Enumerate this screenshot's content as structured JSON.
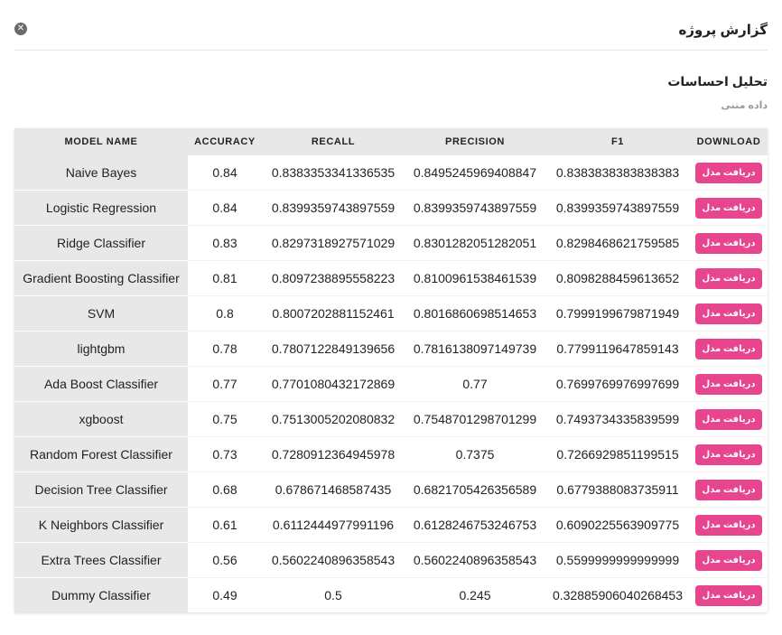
{
  "modal": {
    "title": "گزارش پروژه",
    "close_icon": "close-icon"
  },
  "section": {
    "title": "تحلیل احساسات",
    "subtitle": "داده متنی"
  },
  "table": {
    "headers": {
      "model_name": "MODEL NAME",
      "accuracy": "ACCURACY",
      "recall": "RECALL",
      "precision": "PRECISION",
      "f1": "F1",
      "download": "DOWNLOAD"
    },
    "download_label": "دریافت مدل",
    "rows": [
      {
        "name": "Naive Bayes",
        "accuracy": "0.84",
        "recall": "0.8383353341336535",
        "precision": "0.8495245969408847",
        "f1": "0.8383838383838383"
      },
      {
        "name": "Logistic Regression",
        "accuracy": "0.84",
        "recall": "0.8399359743897559",
        "precision": "0.8399359743897559",
        "f1": "0.8399359743897559"
      },
      {
        "name": "Ridge Classifier",
        "accuracy": "0.83",
        "recall": "0.8297318927571029",
        "precision": "0.8301282051282051",
        "f1": "0.8298468621759585"
      },
      {
        "name": "Gradient Boosting Classifier",
        "accuracy": "0.81",
        "recall": "0.8097238895558223",
        "precision": "0.8100961538461539",
        "f1": "0.8098288459613652"
      },
      {
        "name": "SVM",
        "accuracy": "0.8",
        "recall": "0.8007202881152461",
        "precision": "0.8016860698514653",
        "f1": "0.7999199679871949"
      },
      {
        "name": "lightgbm",
        "accuracy": "0.78",
        "recall": "0.7807122849139656",
        "precision": "0.7816138097149739",
        "f1": "0.7799119647859143"
      },
      {
        "name": "Ada Boost Classifier",
        "accuracy": "0.77",
        "recall": "0.7701080432172869",
        "precision": "0.77",
        "f1": "0.7699769976997699"
      },
      {
        "name": "xgboost",
        "accuracy": "0.75",
        "recall": "0.7513005202080832",
        "precision": "0.7548701298701299",
        "f1": "0.7493734335839599"
      },
      {
        "name": "Random Forest Classifier",
        "accuracy": "0.73",
        "recall": "0.7280912364945978",
        "precision": "0.7375",
        "f1": "0.7266929851199515"
      },
      {
        "name": "Decision Tree Classifier",
        "accuracy": "0.68",
        "recall": "0.678671468587435",
        "precision": "0.6821705426356589",
        "f1": "0.6779388083735911"
      },
      {
        "name": "K Neighbors Classifier",
        "accuracy": "0.61",
        "recall": "0.6112444977991196",
        "precision": "0.6128246753246753",
        "f1": "0.6090225563909775"
      },
      {
        "name": "Extra Trees Classifier",
        "accuracy": "0.56",
        "recall": "0.5602240896358543",
        "precision": "0.5602240896358543",
        "f1": "0.5599999999999999"
      },
      {
        "name": "Dummy Classifier",
        "accuracy": "0.49",
        "recall": "0.5",
        "precision": "0.245",
        "f1": "0.32885906040268453"
      }
    ]
  },
  "colors": {
    "accent": "#e8458f",
    "header_bg": "#e8e8e8"
  }
}
